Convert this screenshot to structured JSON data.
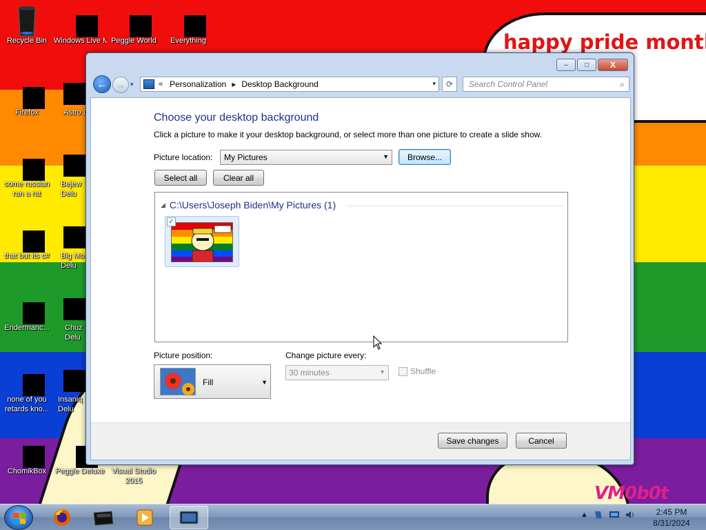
{
  "colors": {
    "accent_heading": "#1e3287",
    "wallpaper_red": "#f20d0d",
    "wallpaper_orange": "#ff8a00",
    "wallpaper_yellow": "#ffea00",
    "wallpaper_green": "#1e9a2a",
    "wallpaper_blue": "#0a3fd6",
    "wallpaper_purple": "#7a1d9e"
  },
  "wallpaper": {
    "bubble_text": "happy pride month",
    "watermark": "VM0b0t"
  },
  "desktop_icons": [
    {
      "label": "Recycle Bin",
      "icon": "recycle-bin-icon"
    },
    {
      "label": "Windows Live Ma",
      "icon": "windows-live-mail-icon"
    },
    {
      "label": "Peggle World",
      "icon": "peggle-world-icon"
    },
    {
      "label": "Everything",
      "icon": "everything-icon"
    },
    {
      "label": "Firefox",
      "icon": "firefox-icon"
    },
    {
      "label": "Astro Delu",
      "icon": "astro-icon"
    },
    {
      "label": "some russian ran a rat",
      "icon": "rat-icon"
    },
    {
      "label": "Bejew Delu",
      "icon": "bejeweled-icon"
    },
    {
      "label": "that but its c#",
      "icon": "stack-icon"
    },
    {
      "label": "Big Mo Delu",
      "icon": "bigmoney-icon"
    },
    {
      "label": "Endermanc...",
      "icon": "enderman-icon"
    },
    {
      "label": "Chuz Delu",
      "icon": "chuzzle-icon"
    },
    {
      "label": "none of you retards kno...",
      "icon": "mystery-icon"
    },
    {
      "label": "Insaniq Delu",
      "icon": "insaniquarium-icon"
    },
    {
      "label": "ChomikBox",
      "icon": "chomikbox-icon"
    },
    {
      "label": "Peggle Deluxe",
      "icon": "peggle-deluxe-icon"
    },
    {
      "label": "Visual Studio 2015",
      "icon": "visual-studio-icon"
    }
  ],
  "window": {
    "nav": {
      "back_glyph": "←",
      "forward_glyph": "→",
      "history_glyph": "▾",
      "chevrons": "«",
      "breadcrumb": [
        "Personalization",
        "Desktop Background"
      ],
      "dropdown_glyph": "▾",
      "refresh_glyph": "⟳",
      "search_placeholder": "Search Control Panel",
      "search_glyph": "⌕"
    },
    "controls": {
      "minimize": "–",
      "maximize": "□",
      "close": "X"
    },
    "heading": "Choose your desktop background",
    "description": "Click a picture to make it your desktop background, or select more than one picture to create a slide show.",
    "picture_location_label": "Picture location:",
    "picture_location_value": "My Pictures",
    "browse_button": "Browse...",
    "select_all_button": "Select all",
    "clear_all_button": "Clear all",
    "gallery": {
      "group_title": "C:\\Users\\Joseph Biden\\My Pictures (1)",
      "items": [
        {
          "checked": true,
          "check_glyph": "✓"
        }
      ]
    },
    "picture_position_label": "Picture position:",
    "picture_position_value": "Fill",
    "change_picture_label": "Change picture every:",
    "change_picture_value": "30 minutes",
    "shuffle_label": "Shuffle",
    "shuffle_checked": false,
    "save_button": "Save changes",
    "cancel_button": "Cancel"
  },
  "taskbar": {
    "items": [
      {
        "name": "firefox",
        "active": false
      },
      {
        "name": "explorer",
        "active": false
      },
      {
        "name": "media",
        "active": false
      },
      {
        "name": "control-panel",
        "active": true
      }
    ],
    "tray_arrow": "▲",
    "clock_time": "2:45 PM",
    "clock_date": "8/31/2024"
  }
}
